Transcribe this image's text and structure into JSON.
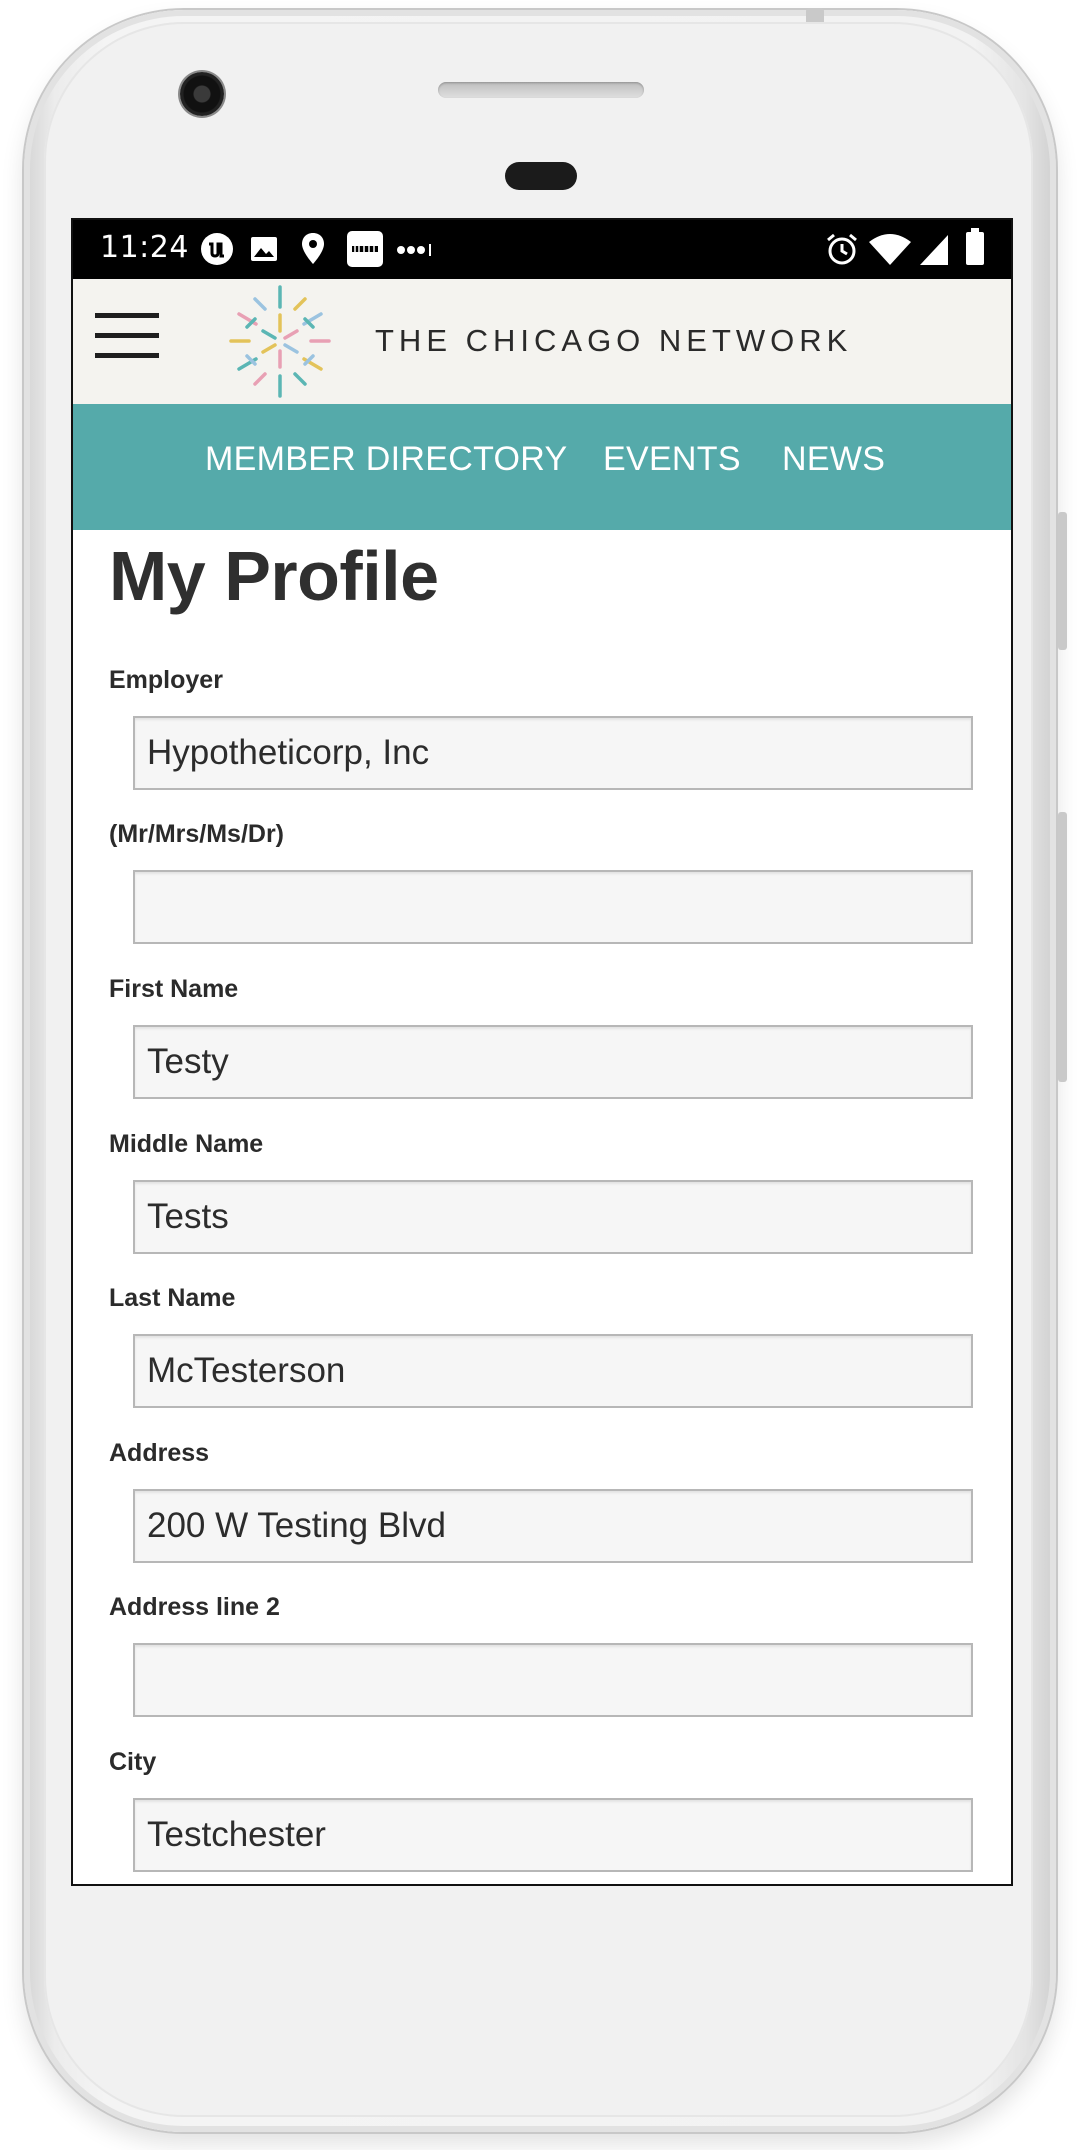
{
  "status_bar": {
    "time": "11:24",
    "left_icons": [
      "u-icon",
      "image-icon",
      "location-pin-icon",
      "ifttt-icon",
      "more-dots-icon"
    ],
    "right_icons": [
      "alarm-icon",
      "wifi-icon",
      "signal-icon",
      "battery-icon"
    ]
  },
  "header": {
    "brand": "THE CHICAGO NETWORK",
    "logo_colors": [
      "#5bb6b4",
      "#e8a0b4",
      "#e3c35a",
      "#9bc3e0"
    ]
  },
  "nav": {
    "items": [
      "MEMBER DIRECTORY",
      "EVENTS",
      "NEWS"
    ],
    "bg_color": "#55aaaa"
  },
  "page": {
    "title": "My Profile",
    "fields": [
      {
        "label": "Employer",
        "value": "Hypotheticorp, Inc"
      },
      {
        "label": "(Mr/Mrs/Ms/Dr)",
        "value": ""
      },
      {
        "label": "First Name",
        "value": "Testy"
      },
      {
        "label": "Middle Name",
        "value": "Tests"
      },
      {
        "label": "Last Name",
        "value": "McTesterson"
      },
      {
        "label": "Address",
        "value": "200 W Testing Blvd"
      },
      {
        "label": "Address line 2",
        "value": ""
      },
      {
        "label": "City",
        "value": "Testchester"
      }
    ]
  }
}
